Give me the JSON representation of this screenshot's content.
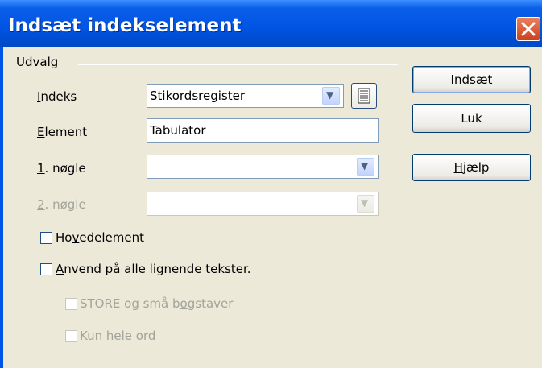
{
  "window": {
    "title": "Indsæt indekselement",
    "close_icon": "close-icon"
  },
  "group": {
    "label": "Udvalg"
  },
  "fields": {
    "index": {
      "label_u": "I",
      "label_rest": "ndeks",
      "value": "Stikordsregister"
    },
    "element": {
      "label_u": "E",
      "label_rest": "lement",
      "value": "Tabulator"
    },
    "key1": {
      "label_u": "1",
      "label_rest": ". nøgle",
      "value": ""
    },
    "key2": {
      "label_u": "2",
      "label_rest": ". nøgle",
      "value": ""
    }
  },
  "checkboxes": {
    "main_entry": {
      "pre": "Ho",
      "u": "v",
      "post": "edelement",
      "checked": false
    },
    "apply_all": {
      "pre": "",
      "u": "A",
      "post": "nvend på alle lignende tekster.",
      "checked": false
    },
    "match_case": {
      "pre": "STORE og små b",
      "u": "o",
      "post": "gstaver",
      "checked": false
    },
    "whole_words": {
      "pre": "",
      "u": "K",
      "post": "un hele ord",
      "checked": false
    }
  },
  "buttons": {
    "insert": "Indsæt",
    "close": "Luk",
    "help_u": "H",
    "help_rest": "jælp"
  },
  "colors": {
    "titlebar": "#0054e3",
    "dialog_bg": "#ece9d8",
    "close_button": "#d0401b"
  }
}
